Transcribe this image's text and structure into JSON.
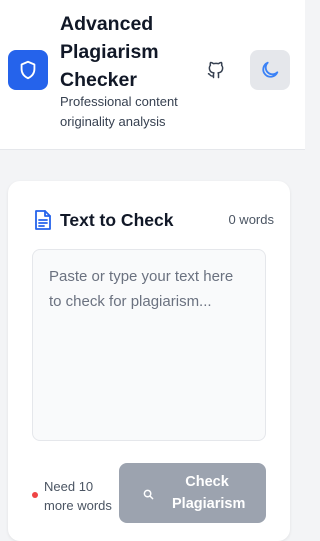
{
  "header": {
    "title": "Advanced Plagiarism Checker",
    "subtitle": "Professional content originality analysis",
    "logo_icon": "shield-icon",
    "github_icon": "github-icon",
    "theme_icon": "moon-icon",
    "colors": {
      "brand": "#2563eb",
      "theme_button_bg": "#e5e7eb",
      "moon": "#3b82f6"
    }
  },
  "editor": {
    "title": "Text to Check",
    "title_icon": "document-icon",
    "word_count": "0 words",
    "placeholder": "Paste or type your text here to check for plagiarism...",
    "value": ""
  },
  "footer": {
    "status_text": "Need 10 more words",
    "status_color": "#ef4444",
    "check_button_label": "Check Plagiarism",
    "check_button_icon": "search-icon",
    "check_button_bg": "#9ca3af"
  }
}
